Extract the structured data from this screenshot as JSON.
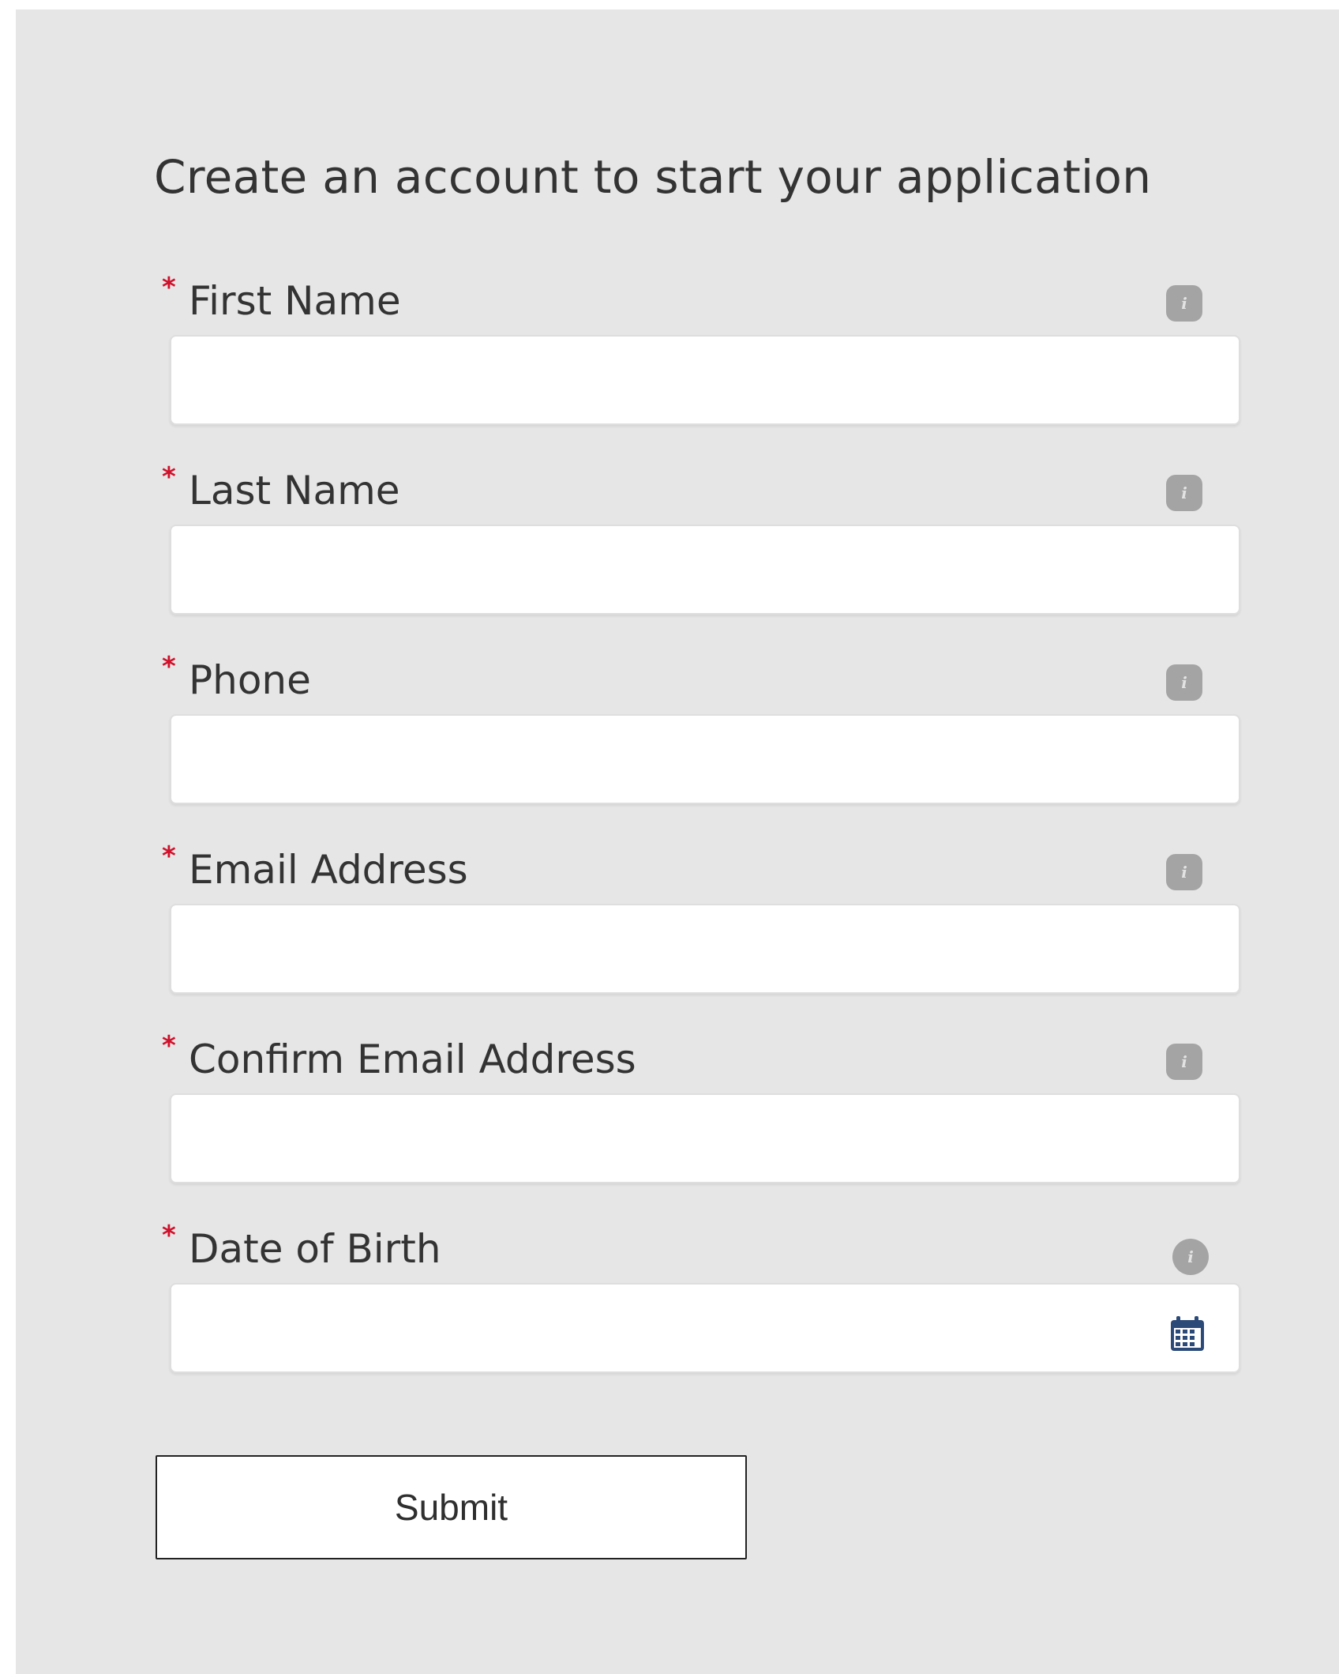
{
  "form": {
    "title": "Create an account to start your application",
    "required_marker": "*",
    "fields": [
      {
        "label": "First Name",
        "value": "",
        "info_icon": "info-icon"
      },
      {
        "label": "Last Name",
        "value": "",
        "info_icon": "info-icon"
      },
      {
        "label": "Phone",
        "value": "",
        "info_icon": "info-icon"
      },
      {
        "label": "Email Address",
        "value": "",
        "info_icon": "info-icon"
      },
      {
        "label": "Confirm Email Address",
        "value": "",
        "info_icon": "info-icon"
      },
      {
        "label": "Date of Birth",
        "value": "",
        "info_icon": "info-icon",
        "trailing_icon": "calendar-icon"
      }
    ],
    "submit_label": "Submit"
  },
  "colors": {
    "panel_background": "#e6e6e6",
    "required_marker": "#d0112b",
    "info_icon": "#a4a4a4",
    "calendar_icon": "#2c4a78",
    "text": "#333333"
  }
}
